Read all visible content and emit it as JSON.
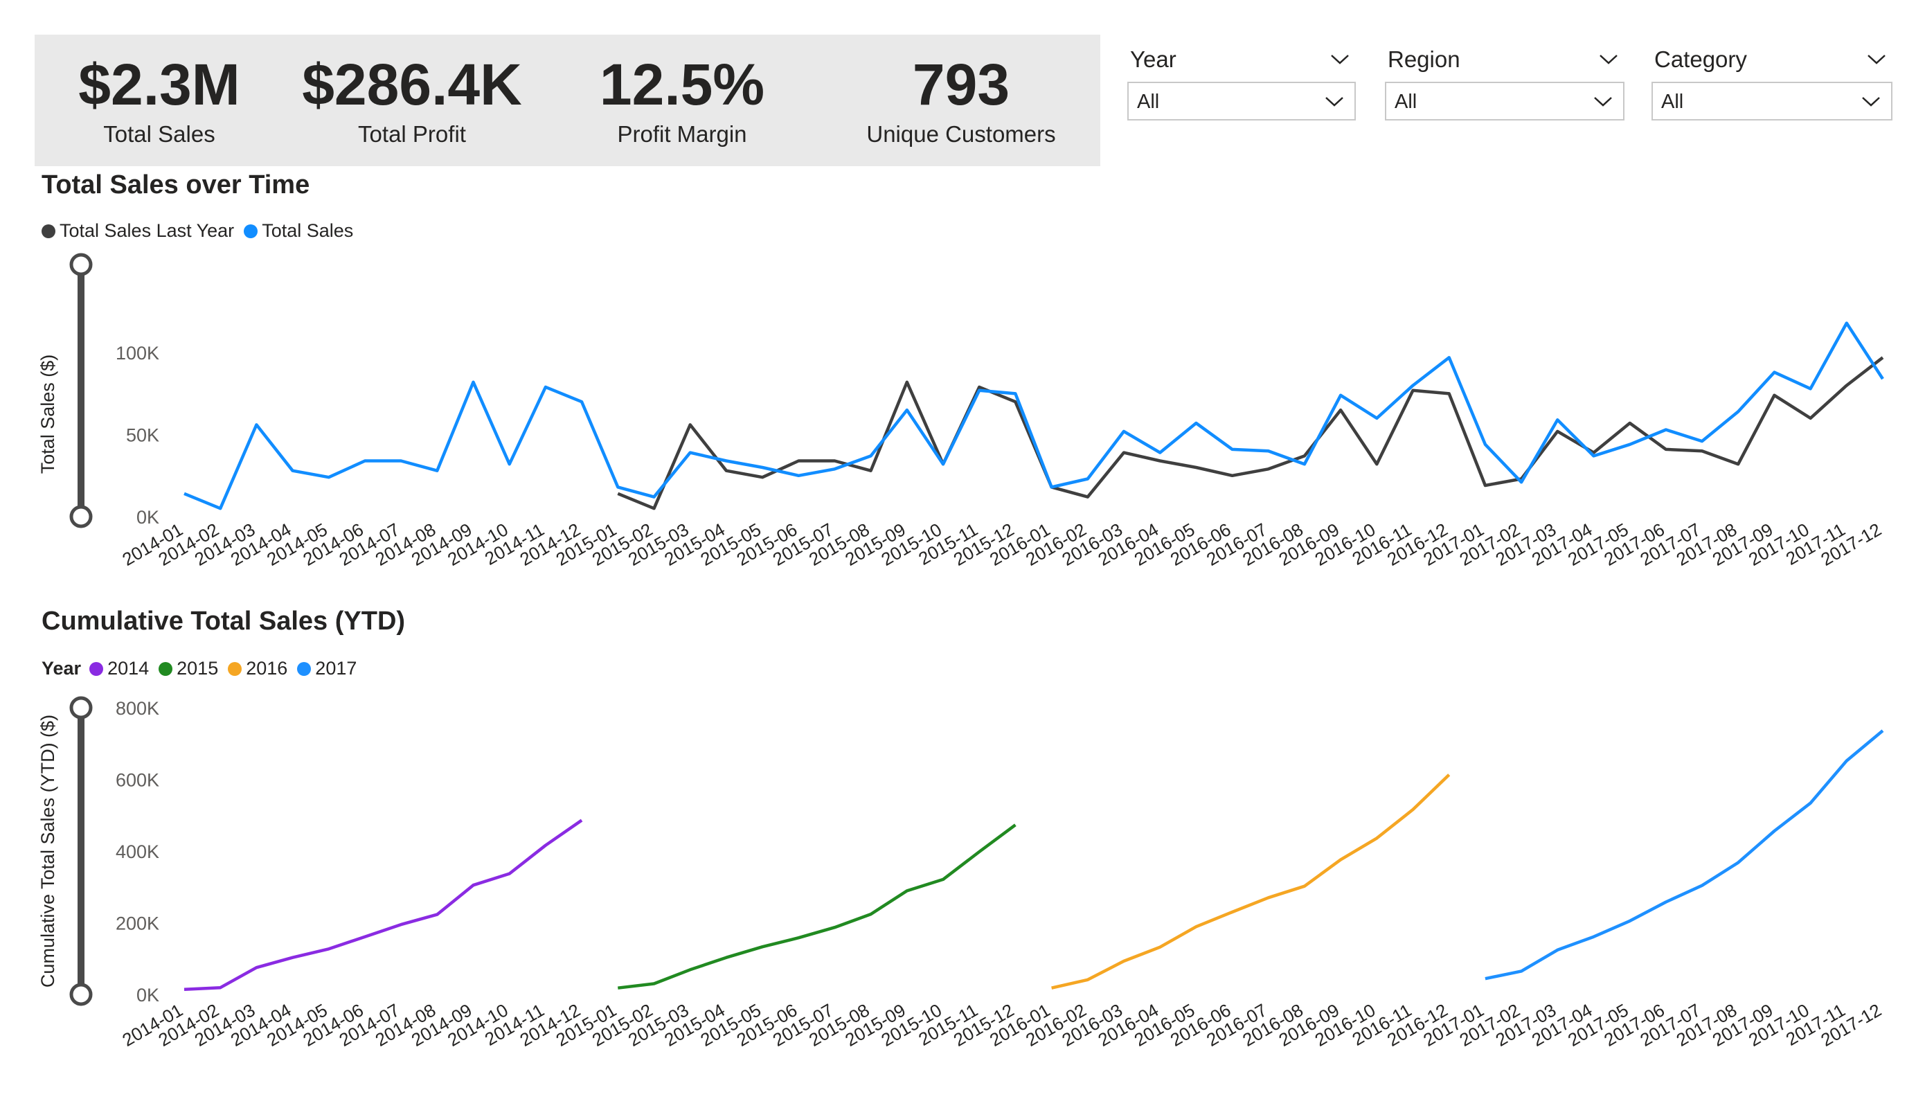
{
  "kpis": [
    {
      "value": "$2.3M",
      "label": "Total Sales"
    },
    {
      "value": "$286.4K",
      "label": "Total Profit"
    },
    {
      "value": "12.5%",
      "label": "Profit Margin"
    },
    {
      "value": "793",
      "label": "Unique Customers"
    }
  ],
  "slicers": [
    {
      "title": "Year",
      "value": "All"
    },
    {
      "title": "Region",
      "value": "All"
    },
    {
      "title": "Category",
      "value": "All"
    }
  ],
  "colors": {
    "total_sales": "#118dff",
    "total_sales_last_year": "#3f3f3f",
    "y2014": "#8a2be2",
    "y2015": "#218a21",
    "y2016": "#f5a623",
    "y2017": "#1e90ff",
    "kpi_background": "#e9e9e9"
  },
  "chart_data": [
    {
      "type": "line",
      "title": "Total Sales over Time",
      "xlabel": "",
      "ylabel": "Total Sales ($)",
      "ylim": [
        0,
        125000
      ],
      "yticks": [
        "0K",
        "50K",
        "100K"
      ],
      "ytick_values": [
        0,
        50000,
        100000
      ],
      "legend_position": "top-left",
      "categories": [
        "2014-01",
        "2014-02",
        "2014-03",
        "2014-04",
        "2014-05",
        "2014-06",
        "2014-07",
        "2014-08",
        "2014-09",
        "2014-10",
        "2014-11",
        "2014-12",
        "2015-01",
        "2015-02",
        "2015-03",
        "2015-04",
        "2015-05",
        "2015-06",
        "2015-07",
        "2015-08",
        "2015-09",
        "2015-10",
        "2015-11",
        "2015-12",
        "2016-01",
        "2016-02",
        "2016-03",
        "2016-04",
        "2016-05",
        "2016-06",
        "2016-07",
        "2016-08",
        "2016-09",
        "2016-10",
        "2016-11",
        "2016-12",
        "2017-01",
        "2017-02",
        "2017-03",
        "2017-04",
        "2017-05",
        "2017-06",
        "2017-07",
        "2017-08",
        "2017-09",
        "2017-10",
        "2017-11",
        "2017-12"
      ],
      "series": [
        {
          "name": "Total Sales Last Year",
          "color": "#3f3f3f",
          "values": [
            null,
            null,
            null,
            null,
            null,
            null,
            null,
            null,
            null,
            null,
            null,
            null,
            14000,
            5000,
            56000,
            28000,
            24000,
            34000,
            34000,
            28000,
            82000,
            32000,
            79000,
            70000,
            18000,
            12000,
            39000,
            34000,
            30000,
            25000,
            29000,
            37000,
            65000,
            32000,
            77000,
            75000,
            19000,
            23000,
            52000,
            39000,
            57000,
            41000,
            40000,
            32000,
            74000,
            60000,
            80000,
            97000
          ]
        },
        {
          "name": "Total Sales",
          "color": "#118dff",
          "values": [
            14000,
            5000,
            56000,
            28000,
            24000,
            34000,
            34000,
            28000,
            82000,
            32000,
            79000,
            70000,
            18000,
            12000,
            39000,
            34000,
            30000,
            25000,
            29000,
            37000,
            65000,
            32000,
            77000,
            75000,
            18000,
            23000,
            52000,
            39000,
            57000,
            41000,
            40000,
            32000,
            74000,
            60000,
            80000,
            97000,
            44000,
            21000,
            59000,
            37000,
            44000,
            53000,
            46000,
            64000,
            88000,
            78000,
            118000,
            84000
          ]
        }
      ]
    },
    {
      "type": "line",
      "title": "Cumulative Total Sales (YTD)",
      "xlabel": "",
      "ylabel": "Cumulative Total Sales (YTD) ($)",
      "ylim": [
        0,
        800000
      ],
      "yticks": [
        "0K",
        "200K",
        "400K",
        "600K",
        "800K"
      ],
      "ytick_values": [
        0,
        200000,
        400000,
        600000,
        800000
      ],
      "legend_title": "Year",
      "legend_position": "top-left",
      "categories": [
        "2014-01",
        "2014-02",
        "2014-03",
        "2014-04",
        "2014-05",
        "2014-06",
        "2014-07",
        "2014-08",
        "2014-09",
        "2014-10",
        "2014-11",
        "2014-12",
        "2015-01",
        "2015-02",
        "2015-03",
        "2015-04",
        "2015-05",
        "2015-06",
        "2015-07",
        "2015-08",
        "2015-09",
        "2015-10",
        "2015-11",
        "2015-12",
        "2016-01",
        "2016-02",
        "2016-03",
        "2016-04",
        "2016-05",
        "2016-06",
        "2016-07",
        "2016-08",
        "2016-09",
        "2016-10",
        "2016-11",
        "2016-12",
        "2017-01",
        "2017-02",
        "2017-03",
        "2017-04",
        "2017-05",
        "2017-06",
        "2017-07",
        "2017-08",
        "2017-09",
        "2017-10",
        "2017-11",
        "2017-12"
      ],
      "series": [
        {
          "name": "2014",
          "color": "#8a2be2",
          "values": [
            14000,
            19000,
            75000,
            103000,
            127000,
            161000,
            195000,
            223000,
            305000,
            337000,
            416000,
            486000,
            null,
            null,
            null,
            null,
            null,
            null,
            null,
            null,
            null,
            null,
            null,
            null,
            null,
            null,
            null,
            null,
            null,
            null,
            null,
            null,
            null,
            null,
            null,
            null,
            null,
            null,
            null,
            null,
            null,
            null,
            null,
            null,
            null,
            null,
            null,
            null
          ]
        },
        {
          "name": "2015",
          "color": "#218a21",
          "values": [
            null,
            null,
            null,
            null,
            null,
            null,
            null,
            null,
            null,
            null,
            null,
            null,
            18000,
            30000,
            69000,
            103000,
            133000,
            158000,
            187000,
            224000,
            289000,
            321000,
            398000,
            473000,
            null,
            null,
            null,
            null,
            null,
            null,
            null,
            null,
            null,
            null,
            null,
            null,
            null,
            null,
            null,
            null,
            null,
            null,
            null,
            null,
            null,
            null,
            null,
            null
          ]
        },
        {
          "name": "2016",
          "color": "#f5a623",
          "values": [
            null,
            null,
            null,
            null,
            null,
            null,
            null,
            null,
            null,
            null,
            null,
            null,
            null,
            null,
            null,
            null,
            null,
            null,
            null,
            null,
            null,
            null,
            null,
            null,
            18000,
            41000,
            93000,
            132000,
            189000,
            230000,
            270000,
            302000,
            376000,
            436000,
            516000,
            613000,
            null,
            null,
            null,
            null,
            null,
            null,
            null,
            null,
            null,
            null,
            null,
            null
          ]
        },
        {
          "name": "2017",
          "color": "#1e90ff",
          "values": [
            null,
            null,
            null,
            null,
            null,
            null,
            null,
            null,
            null,
            null,
            null,
            null,
            null,
            null,
            null,
            null,
            null,
            null,
            null,
            null,
            null,
            null,
            null,
            null,
            null,
            null,
            null,
            null,
            null,
            null,
            null,
            null,
            null,
            null,
            null,
            null,
            44000,
            65000,
            124000,
            161000,
            205000,
            258000,
            304000,
            368000,
            456000,
            534000,
            652000,
            736000
          ]
        }
      ]
    }
  ]
}
